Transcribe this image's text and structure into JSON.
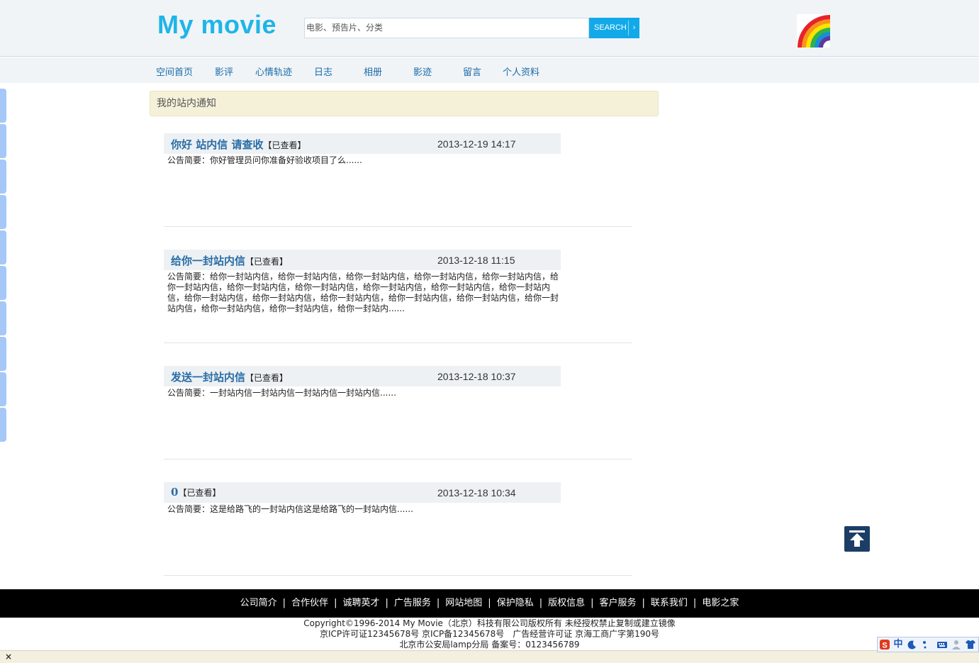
{
  "header": {
    "logo": "My movie",
    "search_placeholder": "电影、预告片、分类",
    "search_button": "SEARCH",
    "search_arrow": "›"
  },
  "nav": {
    "items": [
      {
        "label": "空间首页"
      },
      {
        "label": "影评"
      },
      {
        "label": "心情轨迹"
      },
      {
        "label": "日志"
      },
      {
        "label": "相册"
      },
      {
        "label": "影迹"
      },
      {
        "label": "留言"
      },
      {
        "label": "个人资料"
      }
    ]
  },
  "notice": {
    "title": "我的站内通知"
  },
  "messages": [
    {
      "title": "你好 站内信 请查收",
      "status": "【已查看】",
      "date": "2013-12-19 14:17",
      "summary": "公告简要：你好管理员问你准备好验收项目了么......"
    },
    {
      "title": "给你一封站内信",
      "status": "【已查看】",
      "date": "2013-12-18 11:15",
      "summary": "公告简要：给你一封站内信，给你一封站内信，给你一封站内信，给你一封站内信，给你一封站内信，给你一封站内信，给你一封站内信，给你一封站内信，给你一封站内信，给你一封站内信，给你一封站内信，给你一封站内信，给你一封站内信，给你一封站内信，给你一封站内信，给你一封站内信，给你一封站内信，给你一封站内信，给你一封站内信，给你一封站内......"
    },
    {
      "title": "发送一封站内信",
      "status": "【已查看】",
      "date": "2013-12-18 10:37",
      "summary": "公告简要：一封站内信一封站内信一封站内信一封站内信......"
    },
    {
      "title": "0",
      "status": "【已查看】",
      "date": "2013-12-18 10:34",
      "summary": "公告简要：这是给路飞的一封站内信这是给路飞的一封站内信......"
    }
  ],
  "footer": {
    "links": [
      "公司简介",
      "合作伙伴",
      "诚聘英才",
      "广告服务",
      "网站地图",
      "保护隐私",
      "版权信息",
      "客户服务",
      "联系我们",
      "电影之家"
    ],
    "separator": "|",
    "copyright": "Copyright©1996-2014 My Movie（北京）科技有限公司版权所有 未经授权禁止复制或建立镜像",
    "icp": "京ICP许可证12345678号 京ICP备12345678号　广告经营许可证 京海工商广字第190号",
    "police": "北京市公安局lamp分局 备案号：0123456789"
  },
  "bottom": {
    "close": "×"
  },
  "ime": {
    "lang": "中",
    "icons": [
      "sogou-logo-icon",
      "chinese-mode-icon",
      "moon-icon",
      "punctuation-icon",
      "keyboard-icon",
      "user-icon",
      "skin-icon"
    ]
  },
  "colors": {
    "logo": "#1fb5e8",
    "search_button": "#12a9e8",
    "nav_link": "#1a6ba8",
    "message_title": "#2a6da5",
    "notice_bg": "#f5f1d9",
    "footer_bg": "#000000",
    "side_tab": "#a6c8f9",
    "top_button": "#1c3d66"
  }
}
